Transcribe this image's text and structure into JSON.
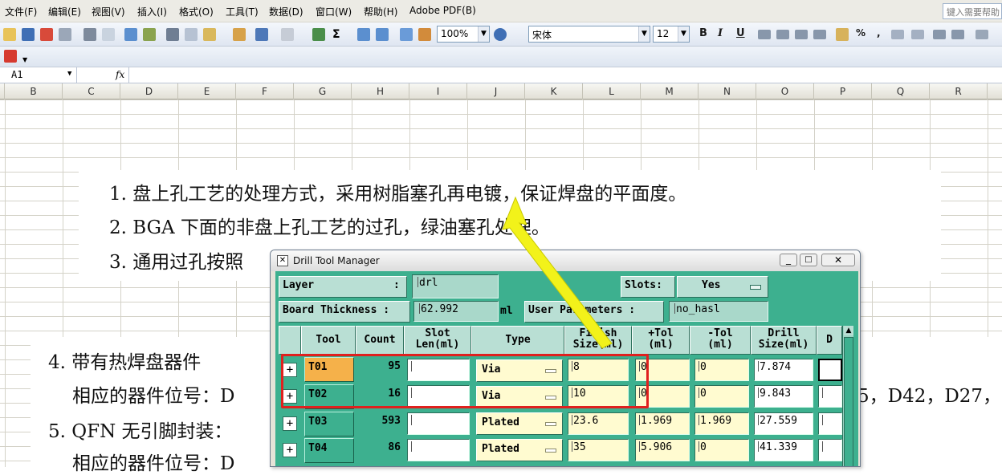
{
  "menubar": {
    "items": [
      "文件(F)",
      "编辑(E)",
      "视图(V)",
      "插入(I)",
      "格式(O)",
      "工具(T)",
      "数据(D)",
      "窗口(W)",
      "帮助(H)",
      "Adobe PDF(B)"
    ],
    "help_placeholder": "键入需要帮助"
  },
  "toolbar": {
    "zoom": "100%",
    "font": "宋体",
    "font_size": "12",
    "bold": "B",
    "italic": "I",
    "underline": "U",
    "percent": "%",
    "comma": ","
  },
  "formula_bar": {
    "cell_ref": "A1",
    "fx": "fx"
  },
  "columns": [
    "B",
    "C",
    "D",
    "E",
    "F",
    "G",
    "H",
    "I",
    "J",
    "K",
    "L",
    "M",
    "N",
    "O",
    "P",
    "Q",
    "R"
  ],
  "document": {
    "lines": [
      "1.  盘上孔工艺的处理方式，采用树脂塞孔再电镀，保证焊盘的平面度。",
      "2.  BGA 下面的非盘上孔工艺的过孔，绿油塞孔处理。",
      "3.  通用过孔按照"
    ],
    "lines2": [
      "4.  带有热焊盘器件",
      "相应的器件位号：D",
      "5. QFN 无引脚封装：",
      "相应的器件位号：D"
    ],
    "right_fragment": "5，D42，D27，"
  },
  "dialog": {
    "title": "Drill Tool Manager",
    "layer_label": "Layer",
    "layer_colon": ":",
    "layer_value": "drl",
    "slots_label": "Slots:",
    "slots_value": "Yes",
    "board_thickness_label": "Board Thickness :",
    "board_thickness_value": "62.992",
    "board_thickness_unit": "ml",
    "user_params_label": "User Parameters :",
    "user_params_value": "no_hasl",
    "headers": [
      "Tool",
      "Count",
      "Slot\nLen(ml)",
      "Type",
      "Finish\nSize(ml)",
      "+Tol\n(ml)",
      "-Tol\n(ml)",
      "Drill\nSize(ml)",
      "D"
    ],
    "rows": [
      {
        "tool": "T01",
        "count": "95",
        "slot": "",
        "type": "Via",
        "finish": "8",
        "ptol": "0",
        "mtol": "0",
        "drill": "7.874"
      },
      {
        "tool": "T02",
        "count": "16",
        "slot": "",
        "type": "Via",
        "finish": "10",
        "ptol": "0",
        "mtol": "0",
        "drill": "9.843"
      },
      {
        "tool": "T03",
        "count": "593",
        "slot": "",
        "type": "Plated",
        "finish": "23.6",
        "ptol": "1.969",
        "mtol": "1.969",
        "drill": "27.559"
      },
      {
        "tool": "T04",
        "count": "86",
        "slot": "",
        "type": "Plated",
        "finish": "35",
        "ptol": "5.906",
        "mtol": "0",
        "drill": "41.339"
      }
    ]
  },
  "colors": {
    "dialog_bg": "#3db08f",
    "selected_tool": "#f5b14a",
    "highlight_box": "#e0201e",
    "arrow": "#f2f21a"
  }
}
